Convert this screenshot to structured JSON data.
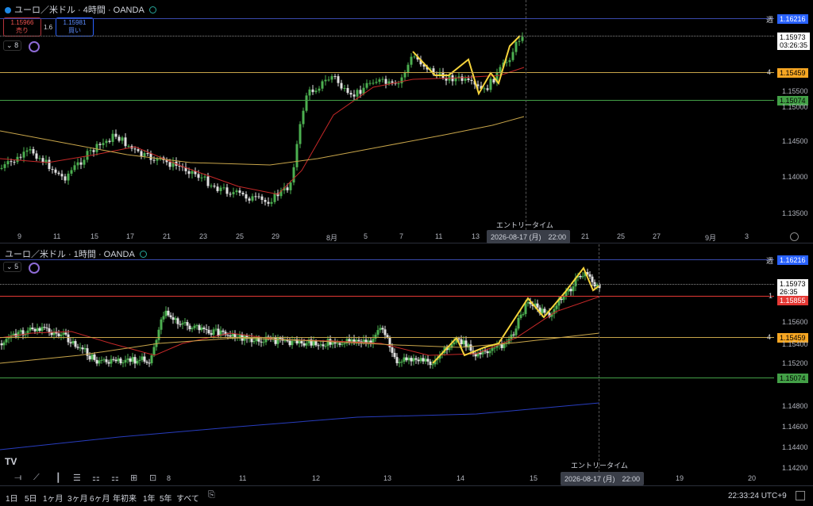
{
  "pane1": {
    "title": "ユーロ／米ドル · 4時間 · OANDA",
    "sell_price": "1.15966",
    "sell_label": "売り",
    "spread": "1.6",
    "buy_price": "1.15981",
    "buy_label": "買い",
    "indicator_count": "8",
    "level_week_tag": "週",
    "level_week": "1.16216",
    "current_price": "1.15973",
    "countdown": "03:26:35",
    "level_4_tag": "4",
    "level_4": "1.15459",
    "level_green": "1.15074",
    "y_ticks": [
      "1.15500",
      "1.15000",
      "1.14500",
      "1.14000",
      "1.13500"
    ],
    "x_ticks": [
      "9",
      "11",
      "15",
      "17",
      "21",
      "23",
      "25",
      "29",
      "8月",
      "5",
      "7",
      "11",
      "13",
      "21",
      "25",
      "27",
      "9月",
      "3"
    ],
    "entry_label": "エントリータイム",
    "entry_date": "2026-08-17 (月)　22:00"
  },
  "pane2": {
    "title": "ユーロ／米ドル · 1時間 · OANDA",
    "indicator_count": "5",
    "level_week_tag": "週",
    "level_week": "1.16216",
    "current_price": "1.15973",
    "countdown": "26:35",
    "level_1_tag": "1",
    "level_red": "1.15855",
    "level_4_tag": "4",
    "level_4": "1.15459",
    "level_green": "1.15074",
    "y_ticks": [
      "1.15600",
      "1.15400",
      "1.15200",
      "1.14800",
      "1.14600",
      "1.14400",
      "1.14200"
    ],
    "x_ticks": [
      "8",
      "11",
      "12",
      "13",
      "14",
      "15",
      "19",
      "20"
    ],
    "entry_label": "エントリータイム",
    "entry_date": "2026-08-17 (月)　22:00"
  },
  "bottom": {
    "timeframes": [
      "1日",
      "5日",
      "1ヶ月",
      "3ヶ月",
      "6ヶ月",
      "年初来",
      "1年",
      "5年",
      "すべて"
    ],
    "clock": "22:33:24 UTC+9"
  },
  "colors": {
    "up": "#4caf50",
    "down": "#e0e0e0",
    "ma_red": "#c62828",
    "ma_orange": "#c8a54a",
    "ma_blue": "#283dbf",
    "zigzag": "#f5d33b",
    "week_line": "#3949ab",
    "level_red": "#e53935",
    "level_orange": "#f6a623",
    "level_green": "#43a047"
  }
}
